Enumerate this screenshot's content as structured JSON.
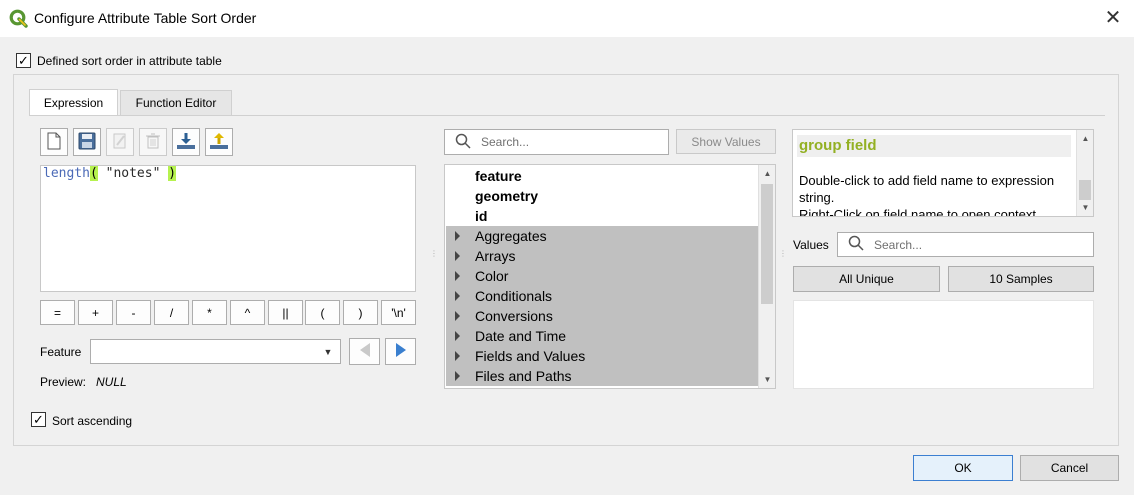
{
  "window": {
    "title": "Configure Attribute Table Sort Order",
    "close_glyph": "✕"
  },
  "options": {
    "defined_sort_order_label": "Defined sort order in attribute table",
    "defined_sort_order_checked": true,
    "sort_ascending_label": "Sort ascending",
    "sort_ascending_checked": true
  },
  "tabs": [
    {
      "label": "Expression",
      "active": true
    },
    {
      "label": "Function Editor",
      "active": false
    }
  ],
  "expression": {
    "toolbar": [
      "new-file-icon",
      "save-icon",
      "edit-icon",
      "delete-icon",
      "import-icon",
      "export-icon"
    ],
    "text_fn": "length",
    "text_open": "(",
    "text_arg": " \"notes\" ",
    "text_close": ")",
    "operators": [
      "=",
      "+",
      "-",
      "/",
      "*",
      "^",
      "||",
      "(",
      ")",
      "'\\n'"
    ],
    "feature_label": "Feature",
    "feature_value": "",
    "preview_label": "Preview:",
    "preview_value": "NULL"
  },
  "function_list": {
    "search_placeholder": "Search...",
    "show_values_label": "Show Values",
    "items": [
      {
        "label": "feature",
        "bold": true,
        "group": false
      },
      {
        "label": "geometry",
        "bold": true,
        "group": false
      },
      {
        "label": "id",
        "bold": true,
        "group": false
      },
      {
        "label": "Aggregates",
        "bold": false,
        "group": true
      },
      {
        "label": "Arrays",
        "bold": false,
        "group": true
      },
      {
        "label": "Color",
        "bold": false,
        "group": true
      },
      {
        "label": "Conditionals",
        "bold": false,
        "group": true
      },
      {
        "label": "Conversions",
        "bold": false,
        "group": true
      },
      {
        "label": "Date and Time",
        "bold": false,
        "group": true
      },
      {
        "label": "Fields and Values",
        "bold": false,
        "group": true
      },
      {
        "label": "Files and Paths",
        "bold": false,
        "group": true
      }
    ]
  },
  "help": {
    "title": "group field",
    "line1": "Double-click to add field name to expression string.",
    "line2": "Right-Click on field name to open context"
  },
  "values": {
    "label": "Values",
    "search_placeholder": "Search...",
    "all_unique_label": "All Unique",
    "samples_label": "10 Samples"
  },
  "buttons": {
    "ok_label": "OK",
    "cancel_label": "Cancel"
  },
  "colors": {
    "group_highlight": "#c0c0c0",
    "help_title": "#93b023",
    "paren_match": "#b6f24f",
    "qgis_green": "#589632"
  }
}
